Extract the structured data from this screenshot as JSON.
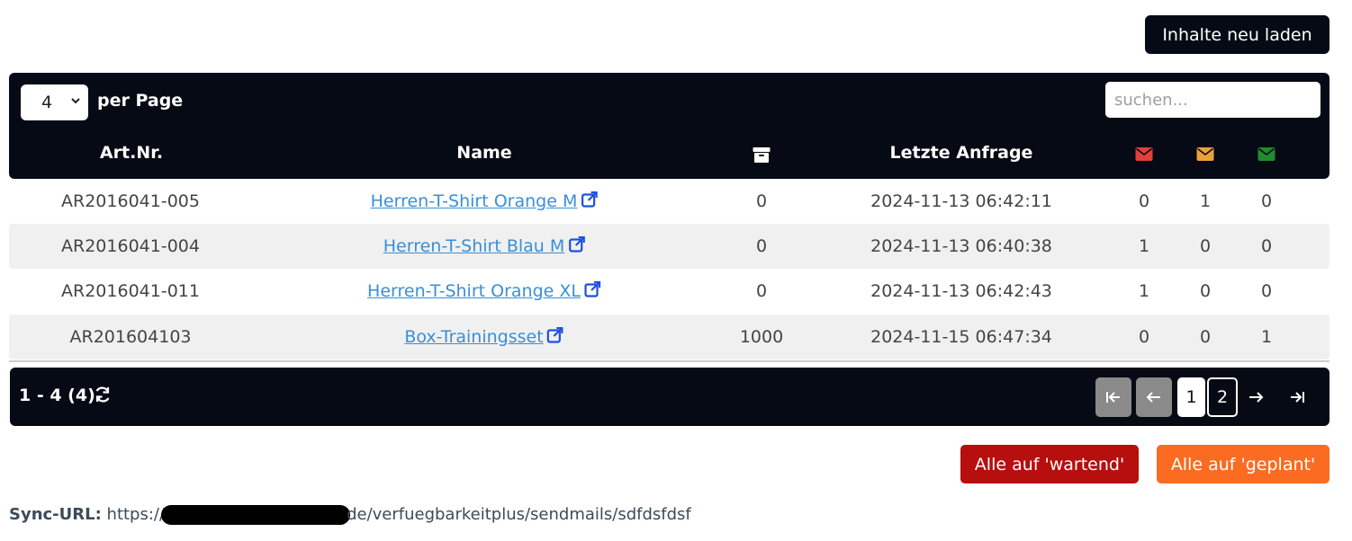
{
  "toolbar": {
    "reload_label": "Inhalte neu laden"
  },
  "table": {
    "per_page_value": "4",
    "per_page_label": "per Page",
    "search_placeholder": "suchen...",
    "columns": {
      "art_nr": "Art.Nr.",
      "name": "Name",
      "stock_icon": "archive-box-icon",
      "last_request": "Letzte Anfrage",
      "mail_red_icon": "envelope-icon",
      "mail_orange_icon": "envelope-icon",
      "mail_green_icon": "envelope-icon"
    },
    "status_colors": {
      "red": "#e0403a",
      "orange": "#e9a13a",
      "green": "#1f8a2e"
    },
    "rows": [
      {
        "art_nr": "AR2016041-005",
        "name": "Herren-T-Shirt Orange M",
        "stock": "0",
        "last_request": "2024-11-13 06:42:11",
        "red": "0",
        "orange": "1",
        "green": "0"
      },
      {
        "art_nr": "AR2016041-004",
        "name": "Herren-T-Shirt Blau M",
        "stock": "0",
        "last_request": "2024-11-13 06:40:38",
        "red": "1",
        "orange": "0",
        "green": "0"
      },
      {
        "art_nr": "AR2016041-011",
        "name": "Herren-T-Shirt Orange XL",
        "stock": "0",
        "last_request": "2024-11-13 06:42:43",
        "red": "1",
        "orange": "0",
        "green": "0"
      },
      {
        "art_nr": "AR201604103",
        "name": "Box-Trainingsset",
        "stock": "1000",
        "last_request": "2024-11-15 06:47:34",
        "red": "0",
        "orange": "0",
        "green": "1"
      }
    ],
    "footer": {
      "range_info": "1 - 4 (4).",
      "pages": [
        "1",
        "2"
      ]
    }
  },
  "actions": {
    "set_waiting_label": "Alle auf 'wartend'",
    "set_planned_label": "Alle auf 'geplant'"
  },
  "sync": {
    "label": "Sync-URL:",
    "url_prefix": "https://",
    "url_suffix": "de/verfuegbarkeitplus/sendmails/sdfdsfdsf"
  }
}
